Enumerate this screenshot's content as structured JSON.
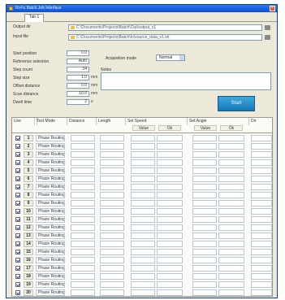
{
  "window": {
    "title": "Ri-Fu Batch Job Interface",
    "close_glyph": "×"
  },
  "tabs": [
    "Tab 1"
  ],
  "paths": [
    {
      "label": "Output dir",
      "value": "C:\\Documents\\Projects\\Batch\\Out\\output_v1"
    },
    {
      "label": "Input file",
      "value": "C:\\Documents\\Projects\\Batch\\In\\source_data_v1.txt"
    }
  ],
  "params": [
    {
      "label": "Start position",
      "value": "0.0",
      "unit": ""
    },
    {
      "label": "Reference selection",
      "value": "Auto",
      "unit": ""
    },
    {
      "label": "Step count",
      "value": "24",
      "unit": ""
    },
    {
      "label": "Step size",
      "value": "1.0",
      "unit": "mm"
    },
    {
      "label": "Offset distance",
      "value": "0.0",
      "unit": "mm"
    },
    {
      "label": "Scan distance",
      "value": "10.0",
      "unit": "mm"
    },
    {
      "label": "Dwell time",
      "value": "2",
      "unit": "s"
    }
  ],
  "mode": {
    "label": "Acquisition mode",
    "value": "Normal"
  },
  "note": {
    "label": "Notes",
    "value": ""
  },
  "run_button": "Start",
  "grid": {
    "headers": [
      "Use",
      "No.",
      "Test Mode",
      "Distance",
      "Length",
      "Set Speed",
      "Set Angle",
      "Dir"
    ],
    "subheaders": [
      "Value",
      "Ok",
      "Value",
      "Ok"
    ],
    "rows": [
      {
        "num": "1",
        "type": "Phase Routing"
      },
      {
        "num": "2",
        "type": "Phase Routing"
      },
      {
        "num": "3",
        "type": "Phase Routing"
      },
      {
        "num": "4",
        "type": "Phase Routing"
      },
      {
        "num": "5",
        "type": "Phase Routing"
      },
      {
        "num": "6",
        "type": "Phase Routing"
      },
      {
        "num": "7",
        "type": "Phase Routing"
      },
      {
        "num": "8",
        "type": "Phase Routing"
      },
      {
        "num": "9",
        "type": "Phase Routing"
      },
      {
        "num": "10",
        "type": "Phase Routing"
      },
      {
        "num": "11",
        "type": "Phase Routing"
      },
      {
        "num": "12",
        "type": "Phase Routing"
      },
      {
        "num": "13",
        "type": "Phase Routing"
      },
      {
        "num": "14",
        "type": "Phase Routing"
      },
      {
        "num": "15",
        "type": "Phase Routing"
      },
      {
        "num": "16",
        "type": "Phase Routing"
      },
      {
        "num": "17",
        "type": "Phase Routing"
      },
      {
        "num": "18",
        "type": "Phase Routing"
      },
      {
        "num": "19",
        "type": "Phase Routing"
      },
      {
        "num": "20",
        "type": "Phase Routing"
      }
    ]
  },
  "colors": {
    "titlebar": "#0b4fd8",
    "window_bg": "#ece9d8",
    "run_button": "#2a8fcc",
    "checkbox_mark": "#1d4fae"
  },
  "icons": [
    "app-icon",
    "close-icon",
    "folder-icon",
    "browse-icon",
    "dropdown-arrow-icon",
    "checkbox-icon"
  ]
}
